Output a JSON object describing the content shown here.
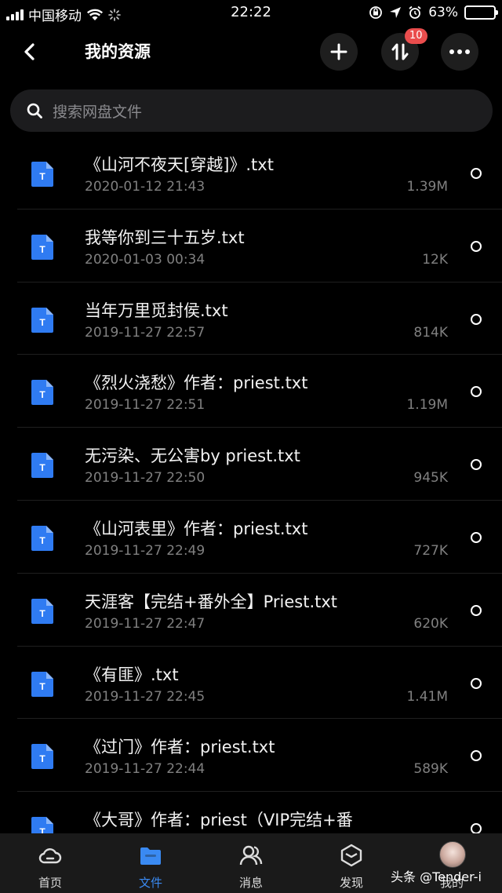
{
  "status_bar": {
    "carrier": "中国移动",
    "time": "22:22",
    "battery": "63%",
    "battery_level": 0.63
  },
  "header": {
    "title": "我的资源",
    "transfer_badge": "10"
  },
  "search": {
    "placeholder": "搜索网盘文件"
  },
  "files": [
    {
      "name": "《山河不夜天[穿越]》.txt",
      "date": "2020-01-12 21:43",
      "size": "1.39M"
    },
    {
      "name": "我等你到三十五岁.txt",
      "date": "2020-01-03 00:34",
      "size": "12K"
    },
    {
      "name": "当年万里觅封侯.txt",
      "date": "2019-11-27 22:57",
      "size": "814K"
    },
    {
      "name": "《烈火浇愁》作者：priest.txt",
      "date": "2019-11-27 22:51",
      "size": "1.19M"
    },
    {
      "name": "无污染、无公害by priest.txt",
      "date": "2019-11-27 22:50",
      "size": "945K"
    },
    {
      "name": "《山河表里》作者：priest.txt",
      "date": "2019-11-27 22:49",
      "size": "727K"
    },
    {
      "name": "天涯客【完结+番外全】Priest.txt",
      "date": "2019-11-27 22:47",
      "size": "620K"
    },
    {
      "name": "《有匪》.txt",
      "date": "2019-11-27 22:45",
      "size": "1.41M"
    },
    {
      "name": "《过门》作者：priest.txt",
      "date": "2019-11-27 22:44",
      "size": "589K"
    },
    {
      "name": "《大哥》作者：priest（VIP完结+番",
      "date": "",
      "size": ""
    }
  ],
  "tabbar": {
    "tabs": [
      {
        "label": "首页",
        "icon": "cloud-icon"
      },
      {
        "label": "文件",
        "icon": "folder-icon"
      },
      {
        "label": "消息",
        "icon": "people-icon"
      },
      {
        "label": "发现",
        "icon": "cube-icon"
      },
      {
        "label": "我的",
        "icon": "avatar"
      }
    ],
    "active_color": "#3a8af2"
  },
  "watermark": "头条 @Tender-i",
  "colors": {
    "file_icon": "#2f7bf2",
    "badge": "#ea4d4d",
    "background": "#000000"
  }
}
